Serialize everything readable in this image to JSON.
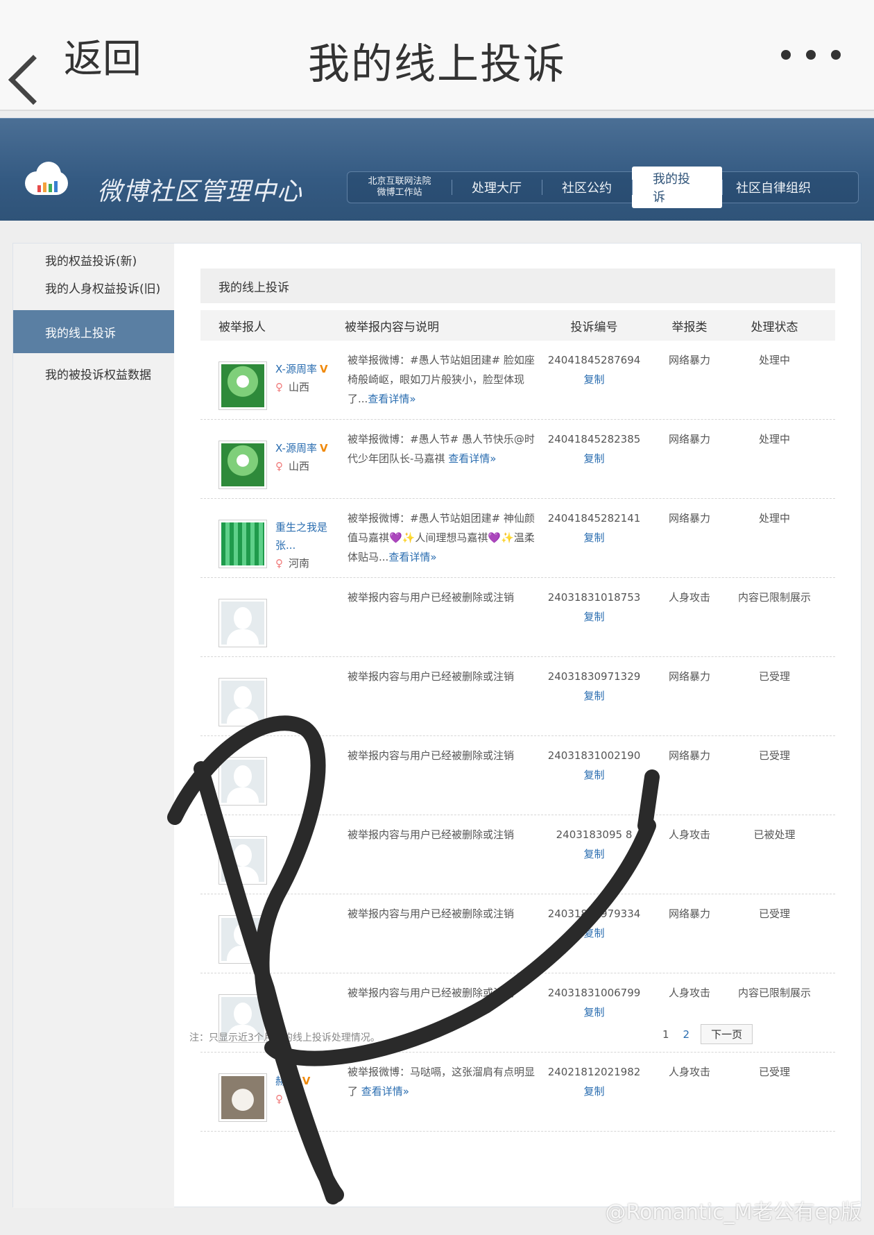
{
  "appbar": {
    "back_label": "返回",
    "title": "我的线上投诉"
  },
  "site": {
    "brand": "微博社区管理中心",
    "nav": {
      "court_line1": "北京互联网法院",
      "court_line2": "微博工作站",
      "items": [
        "处理大厅",
        "社区公约",
        "我的投诉",
        "社区自律组织"
      ],
      "selected": "我的投诉"
    }
  },
  "sidebar": {
    "items": [
      "我的权益投诉(新)",
      "我的人身权益投诉(旧)",
      "我的线上投诉",
      "我的被投诉权益数据"
    ],
    "active": "我的线上投诉"
  },
  "content": {
    "title": "我的线上投诉",
    "columns": [
      "被举报人",
      "被举报内容与说明",
      "投诉编号",
      "举报类",
      "处理状态"
    ],
    "copy_label": "复制",
    "detail_label": "查看详情»",
    "rows": [
      {
        "avatar": "green",
        "name": "X-源周率",
        "verified": "V",
        "region": "山西",
        "desc": "被举报微博：#愚人节站姐团建# 脸如座椅般崎岖，眼如刀片般狭小，脸型体现了...",
        "has_detail": true,
        "id": "24041845287694",
        "type": "网络暴力",
        "status": "处理中"
      },
      {
        "avatar": "green",
        "name": "X-源周率",
        "verified": "V",
        "region": "山西",
        "desc": "被举报微博：#愚人节# 愚人节快乐@时代少年团队长-马嘉祺 ",
        "has_detail": true,
        "id": "24041845282385",
        "type": "网络暴力",
        "status": "处理中"
      },
      {
        "avatar": "green2",
        "name": "重生之我是张...",
        "verified": "",
        "region": "河南",
        "desc": "被举报微博：#愚人节站姐团建# 神仙颜值马嘉祺💜✨人间理想马嘉祺💜✨温柔体贴马...",
        "has_detail": true,
        "id": "24041845282141",
        "type": "网络暴力",
        "status": "处理中"
      },
      {
        "avatar": "ghost",
        "name": "",
        "verified": "",
        "region": "",
        "desc": "被举报内容与用户已经被删除或注销",
        "has_detail": false,
        "id": "24031831018753",
        "type": "人身攻击",
        "status": "内容已限制展示"
      },
      {
        "avatar": "ghost",
        "name": "",
        "verified": "",
        "region": "",
        "desc": "被举报内容与用户已经被删除或注销",
        "has_detail": false,
        "id": "24031830971329",
        "type": "网络暴力",
        "status": "已受理"
      },
      {
        "avatar": "ghost",
        "name": "",
        "verified": "",
        "region": "",
        "desc": "被举报内容与用户已经被删除或注销",
        "has_detail": false,
        "id": "24031831002190",
        "type": "网络暴力",
        "status": "已受理"
      },
      {
        "avatar": "ghost",
        "name": "",
        "verified": "",
        "region": "",
        "desc": "被举报内容与用户已经被删除或注销",
        "has_detail": false,
        "id": "2403183095  8",
        "type": "人身攻击",
        "status": "已被处理"
      },
      {
        "avatar": "ghost",
        "name": "",
        "verified": "",
        "region": "",
        "desc": "被举报内容与用户已经被删除或注销",
        "has_detail": false,
        "id": "24031830979334",
        "type": "网络暴力",
        "status": "已受理"
      },
      {
        "avatar": "ghost",
        "name": "",
        "verified": "",
        "region": "",
        "desc": "被举报内容与用户已经被删除或注销",
        "has_detail": false,
        "id": "24031831006799",
        "type": "人身攻击",
        "status": "内容已限制展示"
      },
      {
        "avatar": "dog",
        "name": "赫  南",
        "verified": "V",
        "region": "  南",
        "desc": "被举报微博：马哒嗝，这张溜肩有点明显了 ",
        "has_detail": true,
        "id": "24021812021982",
        "type": "人身攻击",
        "status": "已受理"
      }
    ],
    "footer_note": "注：只显示近3个月我的线上投诉处理情况。",
    "pager": {
      "pages": [
        "1",
        "2"
      ],
      "current": "1",
      "next_label": "下一页"
    }
  },
  "watermark": "@Romantic_M老公有ep版",
  "colors": {
    "header_blue": "#345a82",
    "sidebar_active": "#5a7fa3",
    "link": "#2a6db0",
    "verified": "#f08a0c"
  }
}
